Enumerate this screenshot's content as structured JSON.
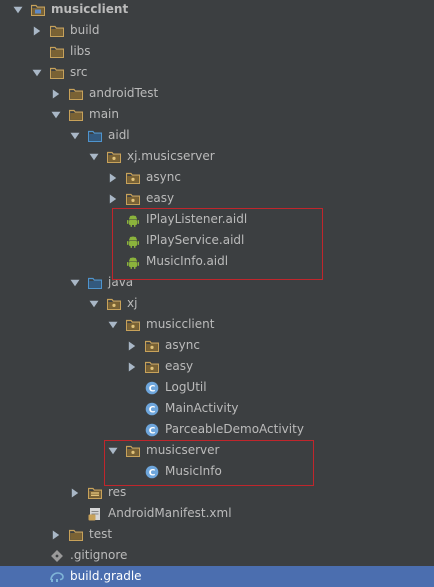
{
  "tree": {
    "rows": [
      {
        "label": "musicclient",
        "icon": "module-folder-icon",
        "expanded": true,
        "bold": true
      },
      {
        "label": "build",
        "icon": "folder-icon",
        "expanded": false
      },
      {
        "label": "libs",
        "icon": "folder-icon",
        "expanded": null
      },
      {
        "label": "src",
        "icon": "folder-icon",
        "expanded": true
      },
      {
        "label": "androidTest",
        "icon": "folder-icon",
        "expanded": false
      },
      {
        "label": "main",
        "icon": "folder-icon",
        "expanded": true
      },
      {
        "label": "aidl",
        "icon": "source-folder-icon",
        "expanded": true
      },
      {
        "label": "xj.musicserver",
        "icon": "package-icon",
        "expanded": true
      },
      {
        "label": "async",
        "icon": "package-icon",
        "expanded": false
      },
      {
        "label": "easy",
        "icon": "package-icon",
        "expanded": false
      },
      {
        "label": "IPlayListener.aidl",
        "icon": "android-icon",
        "expanded": null
      },
      {
        "label": "IPlayService.aidl",
        "icon": "android-icon",
        "expanded": null
      },
      {
        "label": "MusicInfo.aidl",
        "icon": "android-icon",
        "expanded": null
      },
      {
        "label": "java",
        "icon": "source-folder-icon",
        "expanded": true
      },
      {
        "label": "xj",
        "icon": "package-icon",
        "expanded": true
      },
      {
        "label": "musicclient",
        "icon": "package-icon",
        "expanded": true
      },
      {
        "label": "async",
        "icon": "package-icon",
        "expanded": false
      },
      {
        "label": "easy",
        "icon": "package-icon",
        "expanded": false
      },
      {
        "label": "LogUtil",
        "icon": "class-icon",
        "expanded": null
      },
      {
        "label": "MainActivity",
        "icon": "class-icon",
        "expanded": null
      },
      {
        "label": "ParceableDemoActivity",
        "icon": "class-icon",
        "expanded": null
      },
      {
        "label": "musicserver",
        "icon": "package-icon",
        "expanded": true
      },
      {
        "label": "MusicInfo",
        "icon": "class-icon",
        "expanded": null
      },
      {
        "label": "res",
        "icon": "resource-folder-icon",
        "expanded": false
      },
      {
        "label": "AndroidManifest.xml",
        "icon": "manifest-icon",
        "expanded": null
      },
      {
        "label": "test",
        "icon": "folder-icon",
        "expanded": false
      },
      {
        "label": ".gitignore",
        "icon": "git-icon",
        "expanded": null
      },
      {
        "label": "build.gradle",
        "icon": "gradle-icon",
        "expanded": null,
        "selected": true
      }
    ]
  },
  "colors": {
    "background": "#3c3f41",
    "text": "#bbbbbb",
    "selection": "#4b6eaf",
    "highlight_box": "#c0262c",
    "folder": "#c8a25a",
    "android": "#8bb33c",
    "class": "#4e94ce"
  }
}
